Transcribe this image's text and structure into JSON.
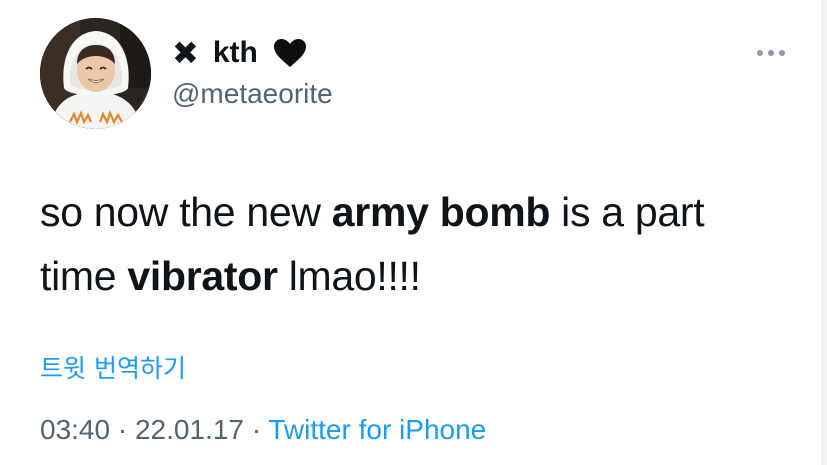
{
  "user": {
    "display_mark": "✖",
    "display_name": "kth",
    "heart_emoji": "black-heart-icon",
    "handle": "@metaeorite"
  },
  "tweet": {
    "text_parts": [
      {
        "text": "so now the new ",
        "bold": false
      },
      {
        "text": "army bomb",
        "bold": true
      },
      {
        "text": " is a part time ",
        "bold": false
      },
      {
        "text": "vibrator",
        "bold": true
      },
      {
        "text": " lmao!!!!",
        "bold": false
      }
    ],
    "translate_label": "트윗 번역하기",
    "time": "03:40",
    "separator": "·",
    "date": "22.01.17",
    "source": "Twitter for iPhone"
  },
  "colors": {
    "text": "#0f1419",
    "secondary": "#536471",
    "link": "#1d9bf0"
  }
}
